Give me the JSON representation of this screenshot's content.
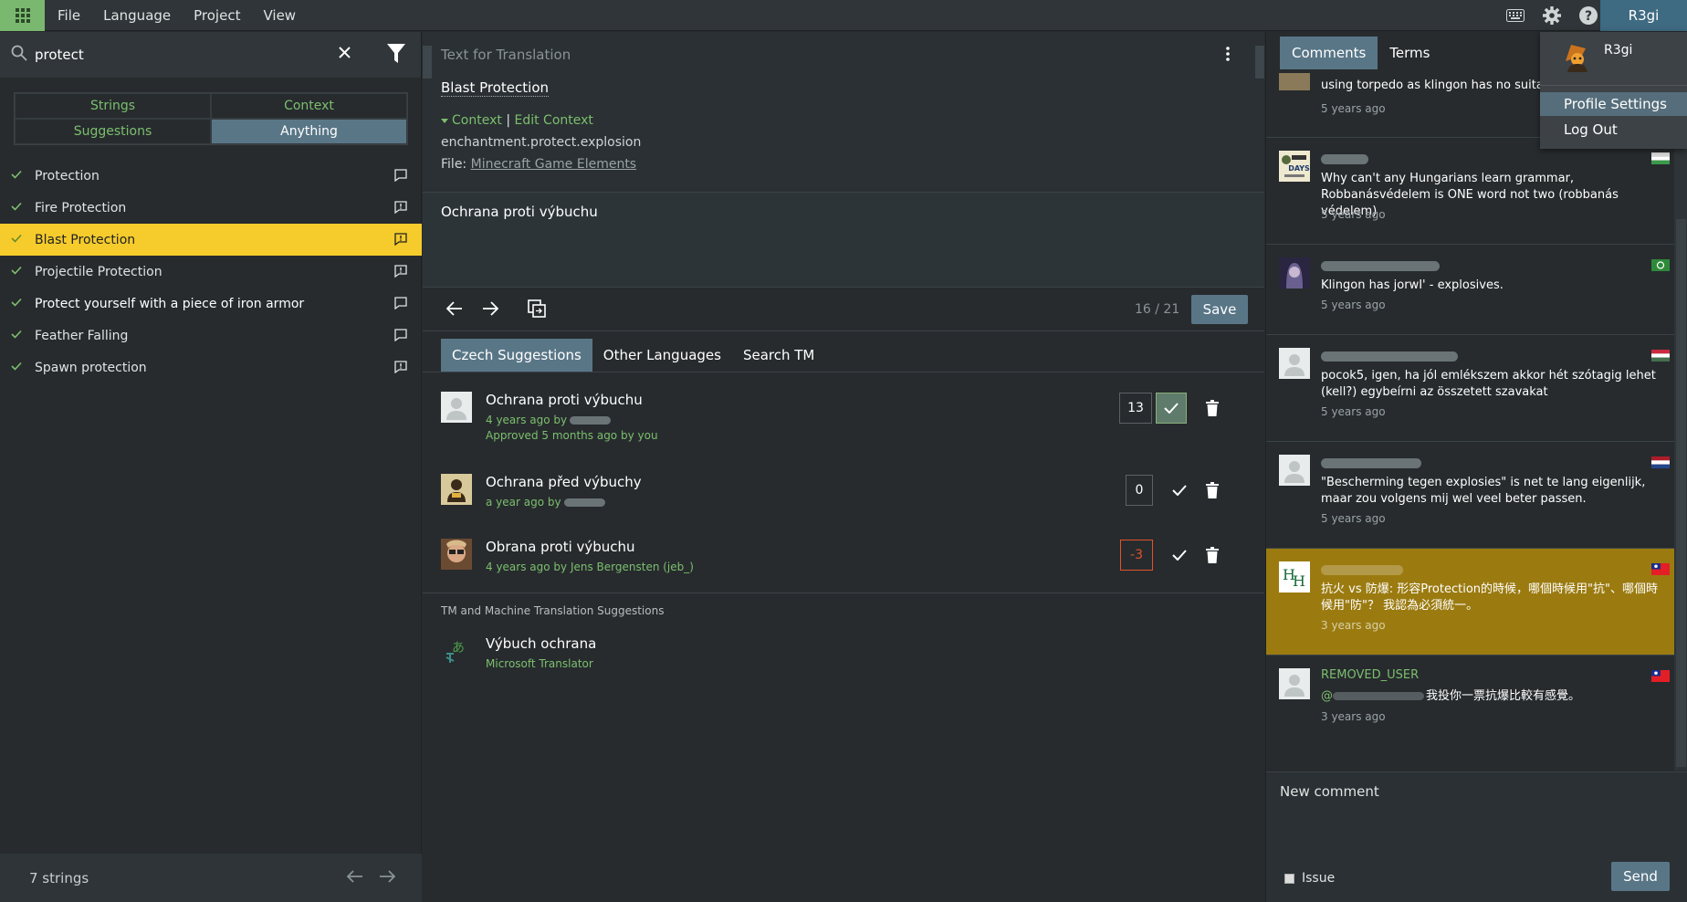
{
  "menu": {
    "items": [
      "File",
      "Language",
      "Project",
      "View"
    ]
  },
  "user": {
    "name": "R3gi"
  },
  "search": {
    "value": "protect"
  },
  "filters": [
    "Strings",
    "Context",
    "Suggestions",
    "Anything"
  ],
  "strings": [
    {
      "label": "Protection"
    },
    {
      "label": "Fire Protection"
    },
    {
      "label": "Blast Protection"
    },
    {
      "label": "Projectile Protection"
    },
    {
      "label": "Protect yourself with a piece of iron armor"
    },
    {
      "label": "Feather Falling"
    },
    {
      "label": "Spawn protection"
    }
  ],
  "footer": {
    "count": "7 strings"
  },
  "editor": {
    "header": "Text for Translation",
    "source": "Blast Protection",
    "context_label": "Context",
    "context_sep": "|",
    "edit_context": "Edit Context",
    "key": "enchantment.protect.explosion",
    "file_label": "File:",
    "file_name": "Minecraft Game Elements",
    "translation": "Ochrana proti výbuchu",
    "progress": "16 / 21",
    "save": "Save"
  },
  "suggestion_tabs": [
    "Czech Suggestions",
    "Other Languages",
    "Search TM"
  ],
  "suggestions": [
    {
      "text": "Ochrana proti výbuchu",
      "meta": "4 years ago by",
      "meta2": "Approved 5 months ago by you",
      "votes": "13"
    },
    {
      "text": "Ochrana před výbuchy",
      "meta": "a year ago by",
      "votes": "0"
    },
    {
      "text": "Obrana proti výbuchu",
      "meta": "4 years ago by Jens Bergensten (jeb_)",
      "votes": "-3"
    }
  ],
  "tm": {
    "header": "TM and Machine Translation Suggestions",
    "text": "Výbuch ochrana",
    "source": "Microsoft Translator"
  },
  "right_tabs": [
    "Comments",
    "Terms"
  ],
  "comments": [
    {
      "body": "using torpedo as klingon has no suitable word",
      "time": "5 years ago"
    },
    {
      "body": "Why can't any Hungarians learn grammar, Robbanásvédelem is ONE word not two (robbanás védelem)",
      "time": "5 years ago"
    },
    {
      "body": "Klingon has jorwI' - explosives.",
      "time": "5 years ago"
    },
    {
      "body": "pocok5, igen, ha jól emlékszem akkor hét szótagig lehet (kell?) egybeírni az összetett szavakat",
      "time": "5 years ago"
    },
    {
      "body": "\"Bescherming tegen explosies\" is net te lang eigenlijk, maar zou volgens mij wel veel beter passen.",
      "time": "5 years ago"
    },
    {
      "body": "抗火 vs 防爆: 形容Protection的時候，哪個時候用\"抗\"、哪個時候用\"防\"？ 我認為必須統一。",
      "time": "3 years ago"
    },
    {
      "name": "REMOVED_USER",
      "body_prefix": "@",
      "body": "我投你一票抗爆比較有感覺。",
      "time": "3 years ago"
    }
  ],
  "new_comment": {
    "placeholder": "New comment",
    "issue": "Issue",
    "send": "Send"
  },
  "dropdown": {
    "name": "R3gi",
    "items": [
      "Profile Settings",
      "Log Out"
    ]
  },
  "colors": {
    "accent": "#597687",
    "green": "#7cbf6d",
    "selected": "#f5cc2c",
    "highlight_comment": "#9b7b10",
    "negative": "#e0532b"
  }
}
